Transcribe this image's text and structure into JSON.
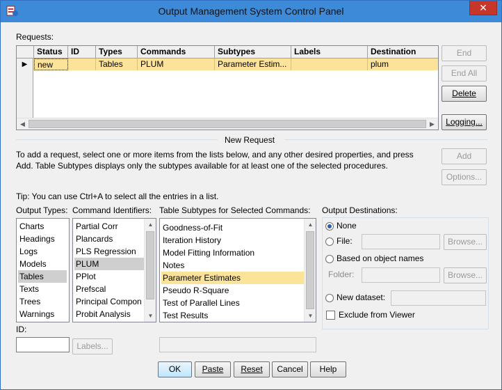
{
  "window": {
    "title": "Output Management System Control Panel",
    "close": "✕"
  },
  "requests": {
    "label": "Requests:",
    "columns": [
      "Status",
      "ID",
      "Types",
      "Commands",
      "Subtypes",
      "Labels",
      "Destination"
    ],
    "row": {
      "marker": "▶",
      "status": "new",
      "id": "",
      "types": "Tables",
      "commands": "PLUM",
      "subtypes": "Parameter Estim...",
      "labels": "",
      "destination": "plum"
    }
  },
  "side_buttons": {
    "end": "End",
    "end_all": "End All",
    "delete": "Delete",
    "logging": "Logging...",
    "add": "Add",
    "options": "Options..."
  },
  "new_request": {
    "heading": "New Request",
    "line1": "To add a request, select one or more items from the lists below, and any other desired properties, and press",
    "line2": "Add. Table Subtypes displays only the subtypes available for at least one of the selected procedures.",
    "tip": "Tip: You can use Ctrl+A to select all the entries in a list."
  },
  "output_types": {
    "label": "Output Types:",
    "items": [
      "Charts",
      "Headings",
      "Logs",
      "Models",
      "Tables",
      "Texts",
      "Trees",
      "Warnings"
    ],
    "selected": "Tables"
  },
  "command_identifiers": {
    "label": "Command Identifiers:",
    "items": [
      "Partial Corr",
      "Plancards",
      "PLS Regression",
      "PLUM",
      "PPlot",
      "Prefscal",
      "Principal Compon",
      "Probit Analysis"
    ],
    "selected": "PLUM"
  },
  "table_subtypes": {
    "label": "Table Subtypes for Selected Commands:",
    "items": [
      "Goodness-of-Fit",
      "Iteration History",
      "Model Fitting Information",
      "Notes",
      "Parameter Estimates",
      "Pseudo R-Square",
      "Test of Parallel Lines",
      "Test Results"
    ],
    "selected": "Parameter Estimates"
  },
  "output_destinations": {
    "label": "Output Destinations:",
    "none": "None",
    "file": "File:",
    "browse1": "Browse...",
    "based_on": "Based on object names",
    "folder": "Folder:",
    "browse2": "Browse...",
    "new_dataset": "New dataset:",
    "exclude": "Exclude from Viewer"
  },
  "id_area": {
    "label": "ID:",
    "id_value": "",
    "labels_button": "Labels..."
  },
  "footer": {
    "ok": "OK",
    "paste": "Paste",
    "reset": "Reset",
    "cancel": "Cancel",
    "help": "Help"
  }
}
